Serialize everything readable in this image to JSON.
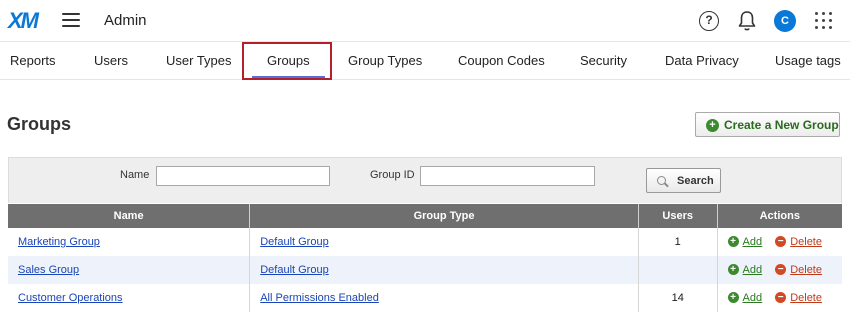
{
  "topbar": {
    "logo": "XM",
    "title": "Admin",
    "help_glyph": "?",
    "avatar_initial": "C",
    "icons": [
      "hamburger-icon",
      "help-icon",
      "bell-icon",
      "avatar",
      "apps-grid-icon"
    ]
  },
  "tabs": [
    {
      "label": "Reports"
    },
    {
      "label": "Users"
    },
    {
      "label": "User Types"
    },
    {
      "label": "Groups",
      "active": true
    },
    {
      "label": "Group Types"
    },
    {
      "label": "Coupon Codes"
    },
    {
      "label": "Security"
    },
    {
      "label": "Data Privacy"
    },
    {
      "label": "Usage tags"
    }
  ],
  "page": {
    "title": "Groups",
    "create_button": "Create a New Group"
  },
  "filter": {
    "name_label": "Name",
    "name_value": "",
    "group_id_label": "Group ID",
    "group_id_value": "",
    "search_button": "Search"
  },
  "table": {
    "columns": [
      "Name",
      "Group Type",
      "Users",
      "Actions"
    ],
    "rows": [
      {
        "name": "Marketing Group",
        "group_type": "Default Group",
        "users": "1",
        "add": "Add",
        "delete": "Delete"
      },
      {
        "name": "Sales Group",
        "group_type": "Default Group",
        "users": "",
        "add": "Add",
        "delete": "Delete"
      },
      {
        "name": "Customer Operations",
        "group_type": "All Permissions Enabled",
        "users": "14",
        "add": "Add",
        "delete": "Delete"
      }
    ]
  },
  "colors": {
    "brand": "#0a78d7",
    "active_tab_outline": "#b3202b",
    "table_header": "#6f6f6f",
    "link": "#1a45b8",
    "add_green": "#3c8a2e",
    "delete_red": "#d04a26"
  }
}
